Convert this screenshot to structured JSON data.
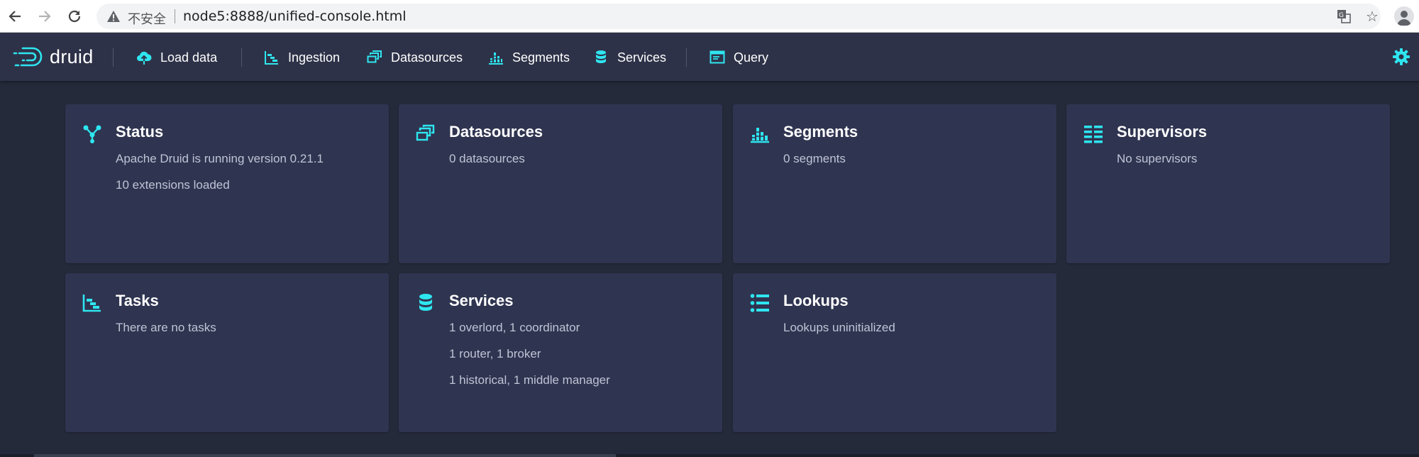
{
  "browser": {
    "insecure_label": "不安全",
    "url": "node5:8888/unified-console.html"
  },
  "navbar": {
    "logo_text": "druid",
    "items": [
      {
        "label": "Load data",
        "icon": "cloud-upload-icon"
      },
      {
        "label": "Ingestion",
        "icon": "gantt-chart-icon"
      },
      {
        "label": "Datasources",
        "icon": "multi-select-icon"
      },
      {
        "label": "Segments",
        "icon": "stacked-chart-icon"
      },
      {
        "label": "Services",
        "icon": "database-icon"
      },
      {
        "label": "Query",
        "icon": "application-icon"
      }
    ]
  },
  "cards": {
    "status": {
      "title": "Status",
      "lines": [
        "Apache Druid is running version 0.21.1",
        "10 extensions loaded"
      ]
    },
    "datasources": {
      "title": "Datasources",
      "lines": [
        "0 datasources"
      ]
    },
    "segments": {
      "title": "Segments",
      "lines": [
        "0 segments"
      ]
    },
    "supervisors": {
      "title": "Supervisors",
      "lines": [
        "No supervisors"
      ]
    },
    "tasks": {
      "title": "Tasks",
      "lines": [
        "There are no tasks"
      ]
    },
    "services": {
      "title": "Services",
      "lines": [
        "1 overlord, 1 coordinator",
        "1 router, 1 broker",
        "1 historical, 1 middle manager"
      ]
    },
    "lookups": {
      "title": "Lookups",
      "lines": [
        "Lookups uninitialized"
      ]
    }
  },
  "colors": {
    "accent": "#2ee6f0",
    "navbar": "#2e3248",
    "background": "#252a3a",
    "card": "#2f3450"
  }
}
